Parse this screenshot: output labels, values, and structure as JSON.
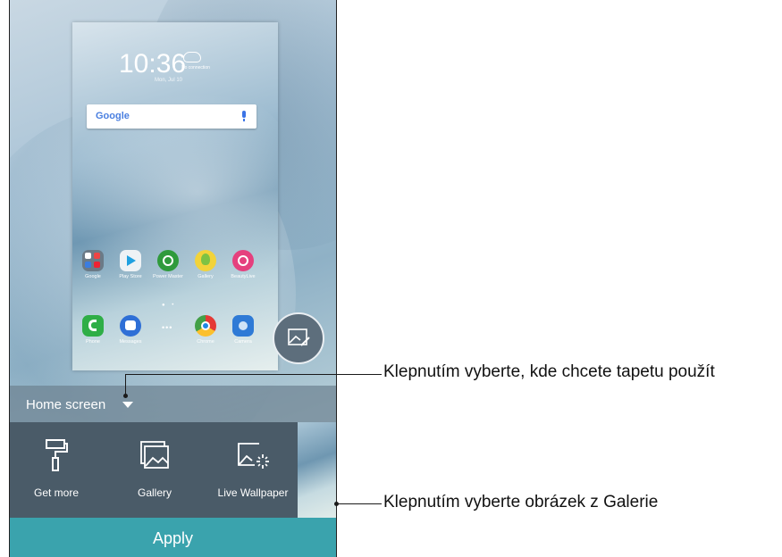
{
  "preview": {
    "clock": "10:36",
    "weather_status": "No connection",
    "date": "Mon, Jul 10",
    "search_logo": "Google",
    "apps_row1": [
      {
        "label": "Google",
        "color": "#6b7a86"
      },
      {
        "label": "Play Store",
        "color": "#e9eef2"
      },
      {
        "label": "Power Master",
        "color": "#2f9a3c"
      },
      {
        "label": "Gallery",
        "color": "#f2d33a"
      },
      {
        "label": "BeautyLive",
        "color": "#e5407e"
      }
    ],
    "apps_row2": [
      {
        "label": "Phone",
        "color": "#2fae47"
      },
      {
        "label": "Messages",
        "color": "#2e6fd6"
      },
      {
        "label": "",
        "color": "transparent"
      },
      {
        "label": "Chrome",
        "color": "#e9eef2"
      },
      {
        "label": "Camera",
        "color": "#2e7ad6"
      }
    ]
  },
  "mode_selector": {
    "label": "Home screen"
  },
  "options": {
    "get_more": "Get more",
    "gallery": "Gallery",
    "live_wallpaper": "Live Wallpaper"
  },
  "apply_label": "Apply",
  "callouts": {
    "mode": "Klepnutím vyberte, kde chcete tapetu použít",
    "gallery": "Klepnutím vyberte obrázek z Galerie"
  }
}
